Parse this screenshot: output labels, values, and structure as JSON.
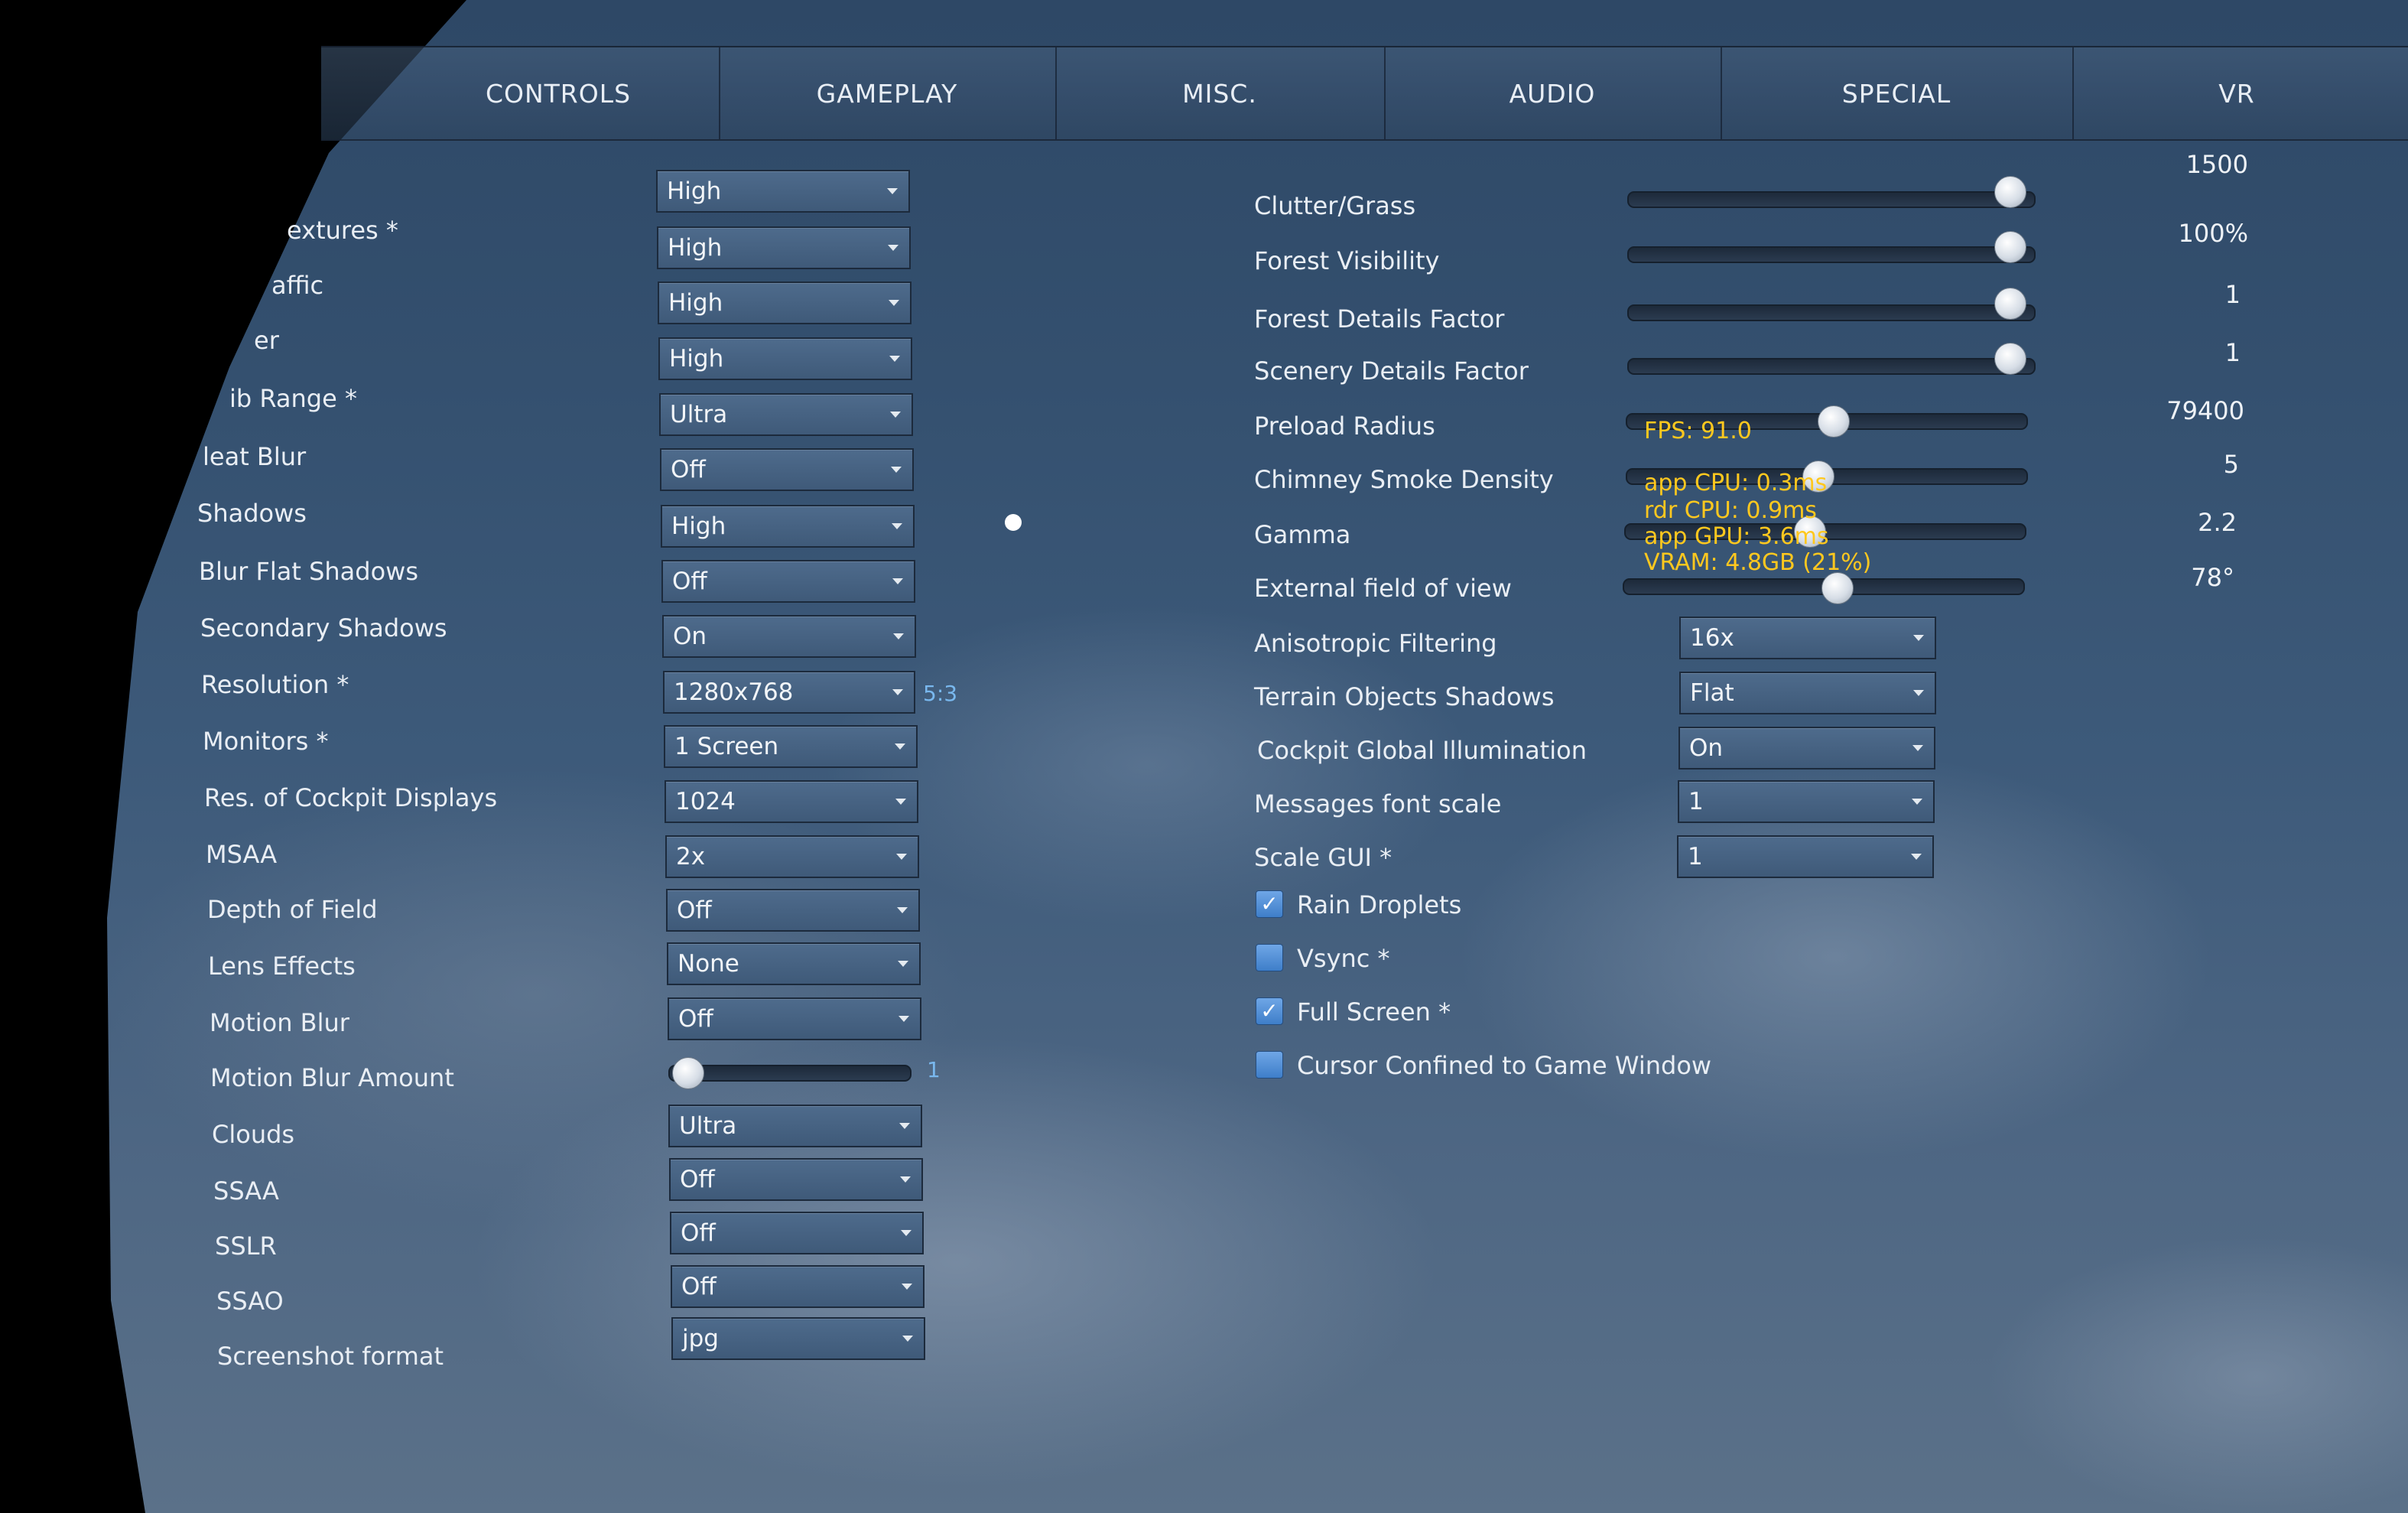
{
  "tabs": [
    "CONTROLS",
    "GAMEPLAY",
    "MISC.",
    "AUDIO",
    "SPECIAL",
    "VR"
  ],
  "left_settings": [
    {
      "label": "",
      "value": "High"
    },
    {
      "label": "extures *",
      "value": "High"
    },
    {
      "label": "affic",
      "value": "High"
    },
    {
      "label": "er",
      "value": "High"
    },
    {
      "label": "ib Range *",
      "value": "Ultra"
    },
    {
      "label": "leat Blur",
      "value": "Off"
    },
    {
      "label": "Shadows",
      "value": "High"
    },
    {
      "label": "Blur Flat Shadows",
      "value": "Off"
    },
    {
      "label": "Secondary Shadows",
      "value": "On"
    },
    {
      "label": "Resolution *",
      "value": "1280x768"
    },
    {
      "label": "Monitors *",
      "value": "1 Screen"
    },
    {
      "label": "Res. of Cockpit Displays",
      "value": "1024"
    },
    {
      "label": "MSAA",
      "value": "2x"
    },
    {
      "label": "Depth of Field",
      "value": "Off"
    },
    {
      "label": "Lens Effects",
      "value": "None"
    },
    {
      "label": "Motion Blur",
      "value": "Off"
    },
    {
      "label": "Clouds",
      "value": "Ultra"
    },
    {
      "label": "SSAA",
      "value": "Off"
    },
    {
      "label": "SSLR",
      "value": "Off"
    },
    {
      "label": "SSAO",
      "value": "Off"
    },
    {
      "label": "Screenshot format",
      "value": "jpg"
    }
  ],
  "resolution_ratio": "5:3",
  "motion_blur_amount": {
    "label": "Motion Blur Amount",
    "value": "1",
    "fraction": 0.02
  },
  "sliders": [
    {
      "label": "Clutter/Grass",
      "value": "1500",
      "fraction": 0.98
    },
    {
      "label": "Forest Visibility",
      "value": "100%",
      "fraction": 0.98
    },
    {
      "label": "Forest Details Factor",
      "value": "1",
      "fraction": 0.98
    },
    {
      "label": "Scenery Details Factor",
      "value": "1",
      "fraction": 0.98
    },
    {
      "label": "Preload Radius",
      "value": "79400",
      "fraction": 0.52
    },
    {
      "label": "Chimney Smoke Density",
      "value": "5",
      "fraction": 0.48
    },
    {
      "label": "Gamma",
      "value": "2.2",
      "fraction": 0.46
    },
    {
      "label": "External field of view",
      "value": "78°",
      "fraction": 0.54
    }
  ],
  "right_settings": [
    {
      "label": "Anisotropic Filtering",
      "value": "16x"
    },
    {
      "label": "Terrain Objects Shadows",
      "value": "Flat"
    },
    {
      "label": "Cockpit Global Illumination",
      "value": "On"
    },
    {
      "label": "Messages font scale",
      "value": "1"
    },
    {
      "label": "Scale GUI *",
      "value": "1"
    }
  ],
  "checkboxes": [
    {
      "label": "Rain Droplets",
      "checked": true
    },
    {
      "label": "Vsync *",
      "checked": false
    },
    {
      "label": "Full Screen *",
      "checked": true
    },
    {
      "label": "Cursor Confined to Game Window",
      "checked": false
    }
  ],
  "perf_overlay": {
    "fps": "FPS: 91.0",
    "app_cpu": "app CPU: 0.3ms",
    "rdr_cpu": "rdr CPU: 0.9ms",
    "app_gpu": "app GPU: 3.6ms",
    "vram": "VRAM: 4.8GB (21%)"
  },
  "colors": {
    "overlay_text": "#ffc81e",
    "ratio_text": "#79b8ee",
    "checkbox": "#4a8ad6"
  }
}
